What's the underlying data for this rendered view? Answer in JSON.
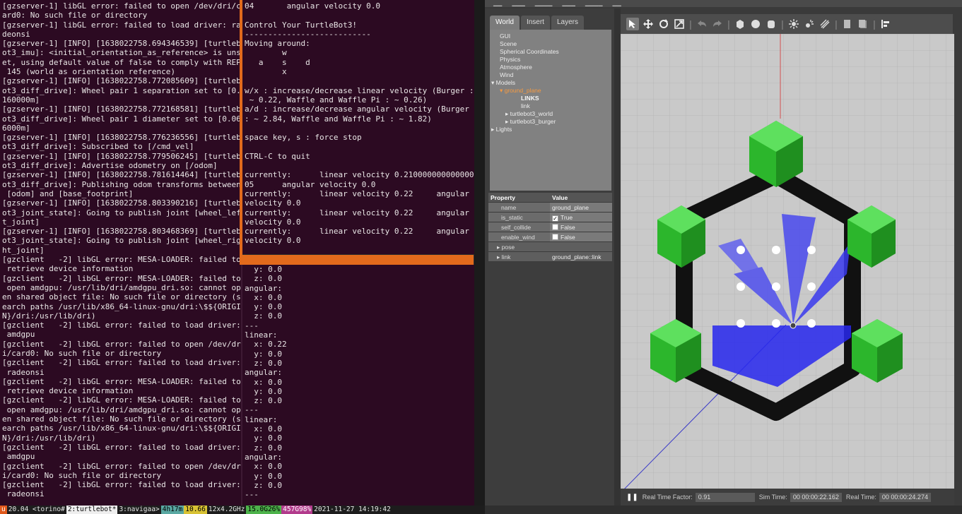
{
  "term_left": [
    "[gzserver-1] libGL error: failed to open /dev/dri/c",
    "ard0: No such file or directory",
    "[gzserver-1] libGL error: failed to load driver: ra",
    "deonsi",
    "[gzserver-1] [INFO] [1638022758.694346539] [turtleb",
    "ot3_imu]: <initial_orientation_as_reference> is uns",
    "et, using default value of false to comply with REP",
    " 145 (world as orientation reference)",
    "[gzserver-1] [INFO] [1638022758.772085609] [turtleb",
    "ot3_diff_drive]: Wheel pair 1 separation set to [0.",
    "160000m]",
    "[gzserver-1] [INFO] [1638022758.772168581] [turtleb",
    "ot3_diff_drive]: Wheel pair 1 diameter set to [0.06",
    "6000m]",
    "[gzserver-1] [INFO] [1638022758.776236556] [turtleb",
    "ot3_diff_drive]: Subscribed to [/cmd_vel]",
    "[gzserver-1] [INFO] [1638022758.779506245] [turtleb",
    "ot3_diff_drive]: Advertise odometry on [/odom]",
    "[gzserver-1] [INFO] [1638022758.781614464] [turtleb",
    "ot3_diff_drive]: Publishing odom transforms between",
    " [odom] and [base_footprint]",
    "[gzserver-1] [INFO] [1638022758.803390216] [turtleb",
    "ot3_joint_state]: Going to publish joint [wheel_lef",
    "t_joint]",
    "[gzserver-1] [INFO] [1638022758.803468369] [turtleb",
    "ot3_joint_state]: Going to publish joint [wheel_rig",
    "ht_joint]",
    "[gzclient   -2] libGL error: MESA-LOADER: failed to",
    " retrieve device information",
    "[gzclient   -2] libGL error: MESA-LOADER: failed to",
    " open amdgpu: /usr/lib/dri/amdgpu_dri.so: cannot op",
    "en shared object file: No such file or directory (s",
    "earch paths /usr/lib/x86_64-linux-gnu/dri:\\$${ORIGI",
    "N}/dri:/usr/lib/dri)",
    "[gzclient   -2] libGL error: failed to load driver:",
    " amdgpu",
    "[gzclient   -2] libGL error: failed to open /dev/dr",
    "i/card0: No such file or directory",
    "[gzclient   -2] libGL error: failed to load driver:",
    " radeonsi",
    "[gzclient   -2] libGL error: MESA-LOADER: failed to",
    " retrieve device information",
    "[gzclient   -2] libGL error: MESA-LOADER: failed to",
    " open amdgpu: /usr/lib/dri/amdgpu_dri.so: cannot op",
    "en shared object file: No such file or directory (s",
    "earch paths /usr/lib/x86_64-linux-gnu/dri:\\$${ORIGI",
    "N}/dri:/usr/lib/dri)",
    "[gzclient   -2] libGL error: failed to load driver:",
    " amdgpu",
    "[gzclient   -2] libGL error: failed to open /dev/dr",
    "i/card0: No such file or directory",
    "[gzclient   -2] libGL error: failed to load driver:",
    " radeonsi"
  ],
  "term_top_right": [
    "04       angular velocity 0.0",
    "",
    "Control Your TurtleBot3!",
    "---------------------------",
    "Moving around:",
    "        w",
    "   a    s    d",
    "        x",
    "",
    "w/x : increase/decrease linear velocity (Burger :",
    " ~ 0.22, Waffle and Waffle Pi : ~ 0.26)",
    "a/d : increase/decrease angular velocity (Burger",
    ": ~ 2.84, Waffle and Waffle Pi : ~ 1.82)",
    "",
    "space key, s : force stop",
    "",
    "CTRL-C to quit",
    "",
    "currently:      linear velocity 0.210000000000000",
    "05      angular velocity 0.0",
    "currently:      linear velocity 0.22     angular",
    "velocity 0.0",
    "currently:      linear velocity 0.22     angular",
    "velocity 0.0",
    "currently:      linear velocity 0.22     angular",
    "velocity 0.0"
  ],
  "term_bottom_right": [
    "  y: 0.0",
    "  z: 0.0",
    "angular:",
    "  x: 0.0",
    "  y: 0.0",
    "  z: 0.0",
    "---",
    "linear:",
    "  x: 0.22",
    "  y: 0.0",
    "  z: 0.0",
    "angular:",
    "  x: 0.0",
    "  y: 0.0",
    "  z: 0.0",
    "---",
    "linear:",
    "  x: 0.0",
    "  y: 0.0",
    "  z: 0.0",
    "angular:",
    "  x: 0.0",
    "  y: 0.0",
    "  z: 0.0",
    "---"
  ],
  "tmux": {
    "s0": "u",
    "s1": " 20.04 <torino# ",
    "s2": "2:turtlebot*",
    "s3": " 3:navigaa>",
    "s4": "4h17m",
    "s5": "10.66",
    "s6": " 12x4.2GHz ",
    "s7": "15.0G26%",
    "s8": "457G98%",
    "s9": " 2021-11-27 14:19:42"
  },
  "gazebo": {
    "tabs": [
      "World",
      "Insert",
      "Layers"
    ],
    "tree": [
      {
        "label": "GUI",
        "cls": "",
        "indent": 14
      },
      {
        "label": "Scene",
        "cls": "",
        "indent": 14
      },
      {
        "label": "Spherical Coordinates",
        "cls": "",
        "indent": 14
      },
      {
        "label": "Physics",
        "cls": "",
        "indent": 14
      },
      {
        "label": "Atmosphere",
        "cls": "",
        "indent": 14
      },
      {
        "label": "Wind",
        "cls": "",
        "indent": 14
      },
      {
        "label": "▾ Models",
        "cls": "",
        "indent": 2
      },
      {
        "label": "▾ ground_plane",
        "cls": "sel",
        "indent": 14
      },
      {
        "label": "LINKS",
        "cls": "bold",
        "indent": 44
      },
      {
        "label": "link",
        "cls": "",
        "indent": 44
      },
      {
        "label": "▸ turtlebot3_world",
        "cls": "",
        "indent": 22
      },
      {
        "label": "▸ turtlebot3_burger",
        "cls": "",
        "indent": 22
      },
      {
        "label": "▸ Lights",
        "cls": "",
        "indent": 2
      }
    ],
    "props_header": {
      "k": "Property",
      "v": "Value"
    },
    "props": {
      "name_k": "name",
      "name_v": "ground_plane",
      "static_k": "is_static",
      "static_v": "True",
      "collide_k": "self_collide",
      "collide_v": "False",
      "wind_k": "enable_wind",
      "wind_v": "False",
      "pose_k": "pose",
      "link_k": "link",
      "link_v": "ground_plane::link"
    },
    "bottom": {
      "pause": "❚❚",
      "rtf_label": "Real Time Factor:",
      "rtf_value": "0.91",
      "sim_label": "Sim Time:",
      "sim_value": "00 00:00:22.162",
      "real_label": "Real Time:",
      "real_value": "00 00:00:24.274"
    },
    "toolbar_icons": [
      "select-arrow",
      "translate",
      "rotate",
      "scale",
      "undo",
      "redo",
      "box",
      "sphere",
      "cylinder",
      "sun-light",
      "point-light",
      "spot-light",
      "copy",
      "paste",
      "align"
    ]
  }
}
